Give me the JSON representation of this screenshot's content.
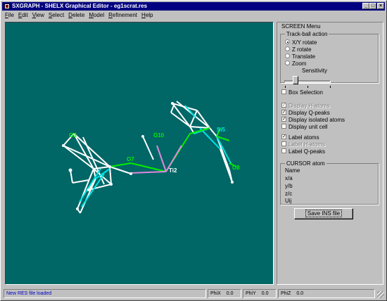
{
  "window": {
    "title": "SXGRAPH - SHELX Graphical Editor - eg1scrat.res",
    "controls": {
      "minimize": "_",
      "maximize": "□",
      "close": "×"
    }
  },
  "menu": [
    "File",
    "Edit",
    "View",
    "Select",
    "Delete",
    "Model",
    "Refinement",
    "Help"
  ],
  "screen_menu": {
    "title": "SCREEN Menu",
    "trackball": {
      "title": "Track-ball action",
      "options": [
        {
          "label": "X/Y rotate",
          "selected": true
        },
        {
          "label": "Z rotate",
          "selected": false
        },
        {
          "label": "Translate",
          "selected": false
        },
        {
          "label": "Zoom",
          "selected": false
        }
      ],
      "sensitivity_label": "Sensitivity",
      "sensitivity_value": 0.2
    },
    "checkboxes": [
      {
        "label": "Box Selection",
        "checked": false,
        "enabled": true
      },
      {
        "label": "Display H-atoms",
        "checked": true,
        "enabled": false
      },
      {
        "label": "Display Q-peaks",
        "checked": true,
        "enabled": true
      },
      {
        "label": "Display isolated atoms",
        "checked": true,
        "enabled": true
      },
      {
        "label": "Display unit cell",
        "checked": false,
        "enabled": true
      },
      {
        "label": "Label atoms",
        "checked": true,
        "enabled": true
      },
      {
        "label": "Label H-atoms",
        "checked": false,
        "enabled": false
      },
      {
        "label": "Label Q-peaks",
        "checked": false,
        "enabled": true
      }
    ],
    "cursor_atom": {
      "title": "CURSOR atom",
      "fields": [
        "Name",
        "x/a",
        "y/b",
        "z/c",
        "Uij"
      ]
    },
    "save_button": "Save INS file"
  },
  "molecule_labels": [
    "O10",
    "O7",
    "Ti2",
    "Si5",
    "O8",
    "O3"
  ],
  "status": {
    "message": "New RES file loaded",
    "phix_label": "PhiX",
    "phix_value": "0.0",
    "phiy_label": "PhiY",
    "phiy_value": "0.0",
    "phiz_label": "PhiZ",
    "phiz_value": "0.0"
  },
  "colors": {
    "canvas": "#006666",
    "bond": "#ffffff",
    "q_bond": "#00ee00",
    "ti_bond": "#dd88dd",
    "cyan": "#00e0e0",
    "label": "#00ff00"
  }
}
